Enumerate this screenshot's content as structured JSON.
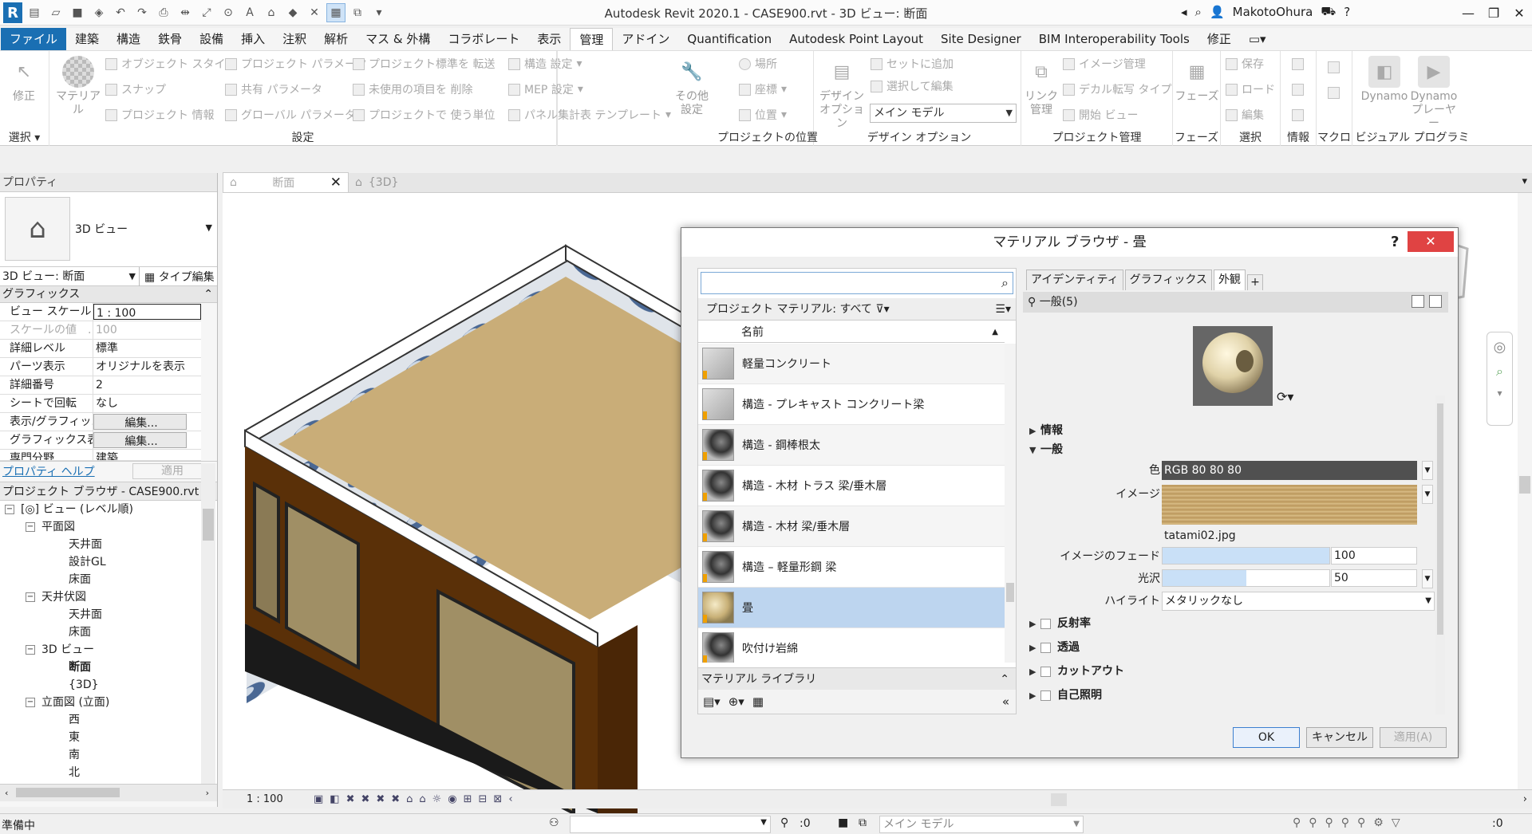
{
  "app": {
    "title": "Autodesk Revit 2020.1 - CASE900.rvt - 3D ビュー: 断面",
    "user": "MakotoOhura"
  },
  "menu_tabs": [
    "ファイル",
    "建築",
    "構造",
    "鉄骨",
    "設備",
    "挿入",
    "注釈",
    "解析",
    "マス & 外構",
    "コラボレート",
    "表示",
    "管理",
    "アドイン",
    "Quantification",
    "Autodesk Point Layout",
    "Site Designer",
    "BIM Interoperability Tools",
    "修正"
  ],
  "ribbon": {
    "modify": "修正",
    "select_panel": "選択",
    "material": "マテリアル",
    "object_style": "オブジェクト スタイル",
    "snap": "スナップ",
    "project_info": "プロジェクト 情報",
    "project_param": "プロジェクト パラメータ",
    "shared_param": "共有 パラメータ",
    "global_param": "グローバル パラメータ",
    "transfer_std": "プロジェクト標準を 転送",
    "purge": "未使用の項目を 削除",
    "units": "プロジェクトで 使う単位",
    "struct_settings": "構造 設定",
    "mep_settings": "MEP 設定",
    "panel_sched": "パネル集計表 テンプレート",
    "other_settings": "その他 設定",
    "settings_panel": "設定",
    "location": "場所",
    "coordinates": "座標",
    "position": "位置",
    "project_location_panel": "プロジェクトの位置",
    "design_option": "デザイン オプション",
    "add_to_set": "セットに追加",
    "pick_to_edit": "選択して編集",
    "main_model": "メイン モデル",
    "design_option_panel": "デザイン オプション",
    "link_manage": "リンク 管理",
    "image_manage": "イメージ管理",
    "decal_types": "デカル転写 タイプ",
    "starting_view": "開始 ビュー",
    "project_manage_panel": "プロジェクト管理",
    "phases": "フェーズ",
    "phases_panel": "フェーズ",
    "save": "保存",
    "load": "ロード",
    "edit": "編集",
    "selection_panel": "選択",
    "info_panel": "情報",
    "macro_panel": "マクロ",
    "dynamo": "Dynamo",
    "dynamo_player": "Dynamo プレーヤー",
    "visual_prog_panel": "ビジュアル プログラミング"
  },
  "properties": {
    "title": "プロパティ",
    "type_name": "3D ビュー",
    "view_select": "3D ビュー: 断面",
    "type_edit": "タイプ編集",
    "group": "グラフィックス",
    "rows": [
      {
        "k": "ビュー スケール",
        "v": "1 : 100"
      },
      {
        "k": "スケールの値　...",
        "v": "100"
      },
      {
        "k": "詳細レベル",
        "v": "標準"
      },
      {
        "k": "パーツ表示",
        "v": "オリジナルを表示"
      },
      {
        "k": "詳細番号",
        "v": "2"
      },
      {
        "k": "シートで回転",
        "v": "なし"
      },
      {
        "k": "表示/グラフィッ...",
        "v": "編集..."
      },
      {
        "k": "グラフィックス表...",
        "v": "編集..."
      },
      {
        "k": "専門分野",
        "v": "建築"
      }
    ],
    "help_link": "プロパティ ヘルプ",
    "apply": "適用"
  },
  "browser": {
    "title": "プロジェクト ブラウザ - CASE900.rvt",
    "nodes": [
      {
        "label": "ビュー (レベル順)",
        "exp": "−"
      },
      {
        "label": "平面図",
        "exp": "−"
      },
      {
        "label": "天井面"
      },
      {
        "label": "設計GL"
      },
      {
        "label": "床面"
      },
      {
        "label": "天井伏図",
        "exp": "−"
      },
      {
        "label": "天井面"
      },
      {
        "label": "床面"
      },
      {
        "label": "3D ビュー",
        "exp": "−"
      },
      {
        "label": "断面"
      },
      {
        "label": "{3D}"
      },
      {
        "label": "立面図 (立面)",
        "exp": "−"
      },
      {
        "label": "西"
      },
      {
        "label": "東"
      },
      {
        "label": "南"
      },
      {
        "label": "北"
      }
    ]
  },
  "view_tabs": [
    "断面",
    "{3D}"
  ],
  "view_scale": "1 : 100",
  "status": {
    "text": "準備中",
    "count": ":0",
    "main_model": "メイン モデル",
    "filter_count": ":0"
  },
  "dialog": {
    "title": "マテリアル ブラウザ - 畳",
    "help": "?",
    "search_placeholder": "",
    "filter_label": "プロジェクト マテリアル: すべて",
    "col_name": "名前",
    "materials": [
      {
        "name": "軽量コンクリート",
        "thumb": "gray"
      },
      {
        "name": "構造 - プレキャスト コンクリート梁",
        "thumb": "gray"
      },
      {
        "name": "構造 - 鋼棒根太",
        "thumb": "ball"
      },
      {
        "name": "構造 - 木材 トラス 梁/垂木層",
        "thumb": "ball"
      },
      {
        "name": "構造 - 木材 梁/垂木層",
        "thumb": "ball"
      },
      {
        "name": "構造 – 軽量形鋼 梁",
        "thumb": "ball"
      },
      {
        "name": "畳",
        "thumb": "tatami"
      },
      {
        "name": "吹付け岩綿",
        "thumb": "ball"
      }
    ],
    "library_label": "マテリアル ライブラリ",
    "tabs": [
      "アイデンティティ",
      "グラフィックス",
      "外観"
    ],
    "asset_name": "一般(5)",
    "sections": {
      "info": "情報",
      "general": "一般",
      "reflectivity": "反射率",
      "transparency": "透過",
      "cutout": "カットアウト",
      "self_illum": "自己照明"
    },
    "fields": {
      "color_label": "色",
      "color_value": "RGB 80 80 80",
      "image_label": "イメージ",
      "image_file": "tatami02.jpg",
      "fade_label": "イメージのフェード",
      "fade_value": "100",
      "gloss_label": "光沢",
      "gloss_value": "50",
      "highlight_label": "ハイライト",
      "highlight_value": "メタリックなし"
    },
    "buttons": {
      "ok": "OK",
      "cancel": "キャンセル",
      "apply": "適用(A)"
    }
  },
  "colors": {
    "accent": "#1a6fb3",
    "selection": "#bdd5ef",
    "close": "#e04343"
  }
}
